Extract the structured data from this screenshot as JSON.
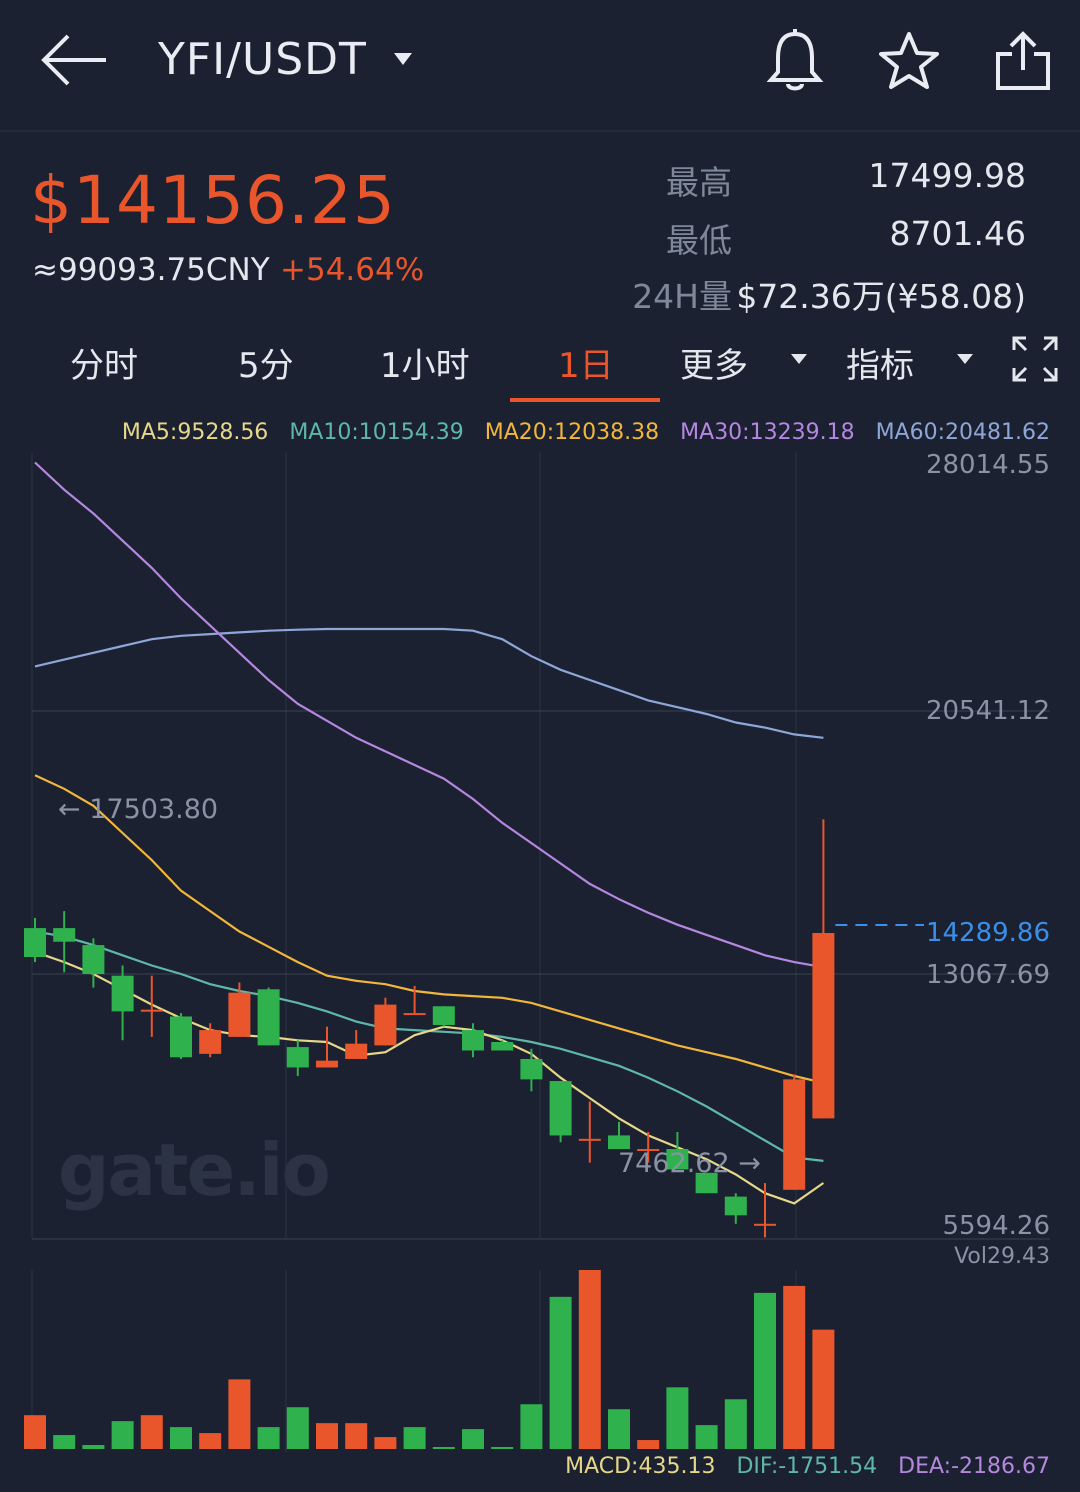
{
  "header": {
    "pair": "YFI/USDT",
    "icons": [
      "back-arrow-icon",
      "caret-down-icon",
      "bell-icon",
      "star-icon",
      "share-icon"
    ]
  },
  "ticker": {
    "price": "$14156.25",
    "cny": "≈99093.75CNY",
    "change": "+54.64%",
    "high_label": "最高",
    "high_value": "17499.98",
    "low_label": "最低",
    "low_value": "8701.46",
    "vol_label": "24H量",
    "vol_value": "$72.36万(¥58.08)"
  },
  "tabs": {
    "items": [
      "分时",
      "5分",
      "1小时",
      "1日",
      "更多",
      "指标"
    ],
    "active": "1日"
  },
  "ma_legend": {
    "ma5": "MA5:9528.56",
    "ma10": "MA10:10154.39",
    "ma20": "MA20:12038.38",
    "ma30": "MA30:13239.18",
    "ma60": "MA60:20481.62"
  },
  "price_axis": {
    "top": "28014.55",
    "mid1": "20541.12",
    "current": "14289.86",
    "mid2": "13067.69",
    "bottom": "5594.26"
  },
  "annotations": {
    "high_marker": "17503.80",
    "low_marker": "7462.62",
    "watermark": "gate.io"
  },
  "volume": {
    "label": "Vol29.43"
  },
  "macd": {
    "macd": "MACD:435.13",
    "dif": "DIF:-1751.54",
    "dea": "DEA:-2186.67"
  },
  "colors": {
    "up": "#e9562c",
    "down": "#2fb24e",
    "ma5": "#e6d789",
    "ma10": "#5fb8a7",
    "ma20": "#f2b63c",
    "ma30": "#b587e0",
    "ma60": "#8ea6d8",
    "current_line": "#3a8fe8"
  },
  "chart_data": {
    "type": "candlestick",
    "y_range": [
      5594.26,
      28014.55
    ],
    "candles": [
      {
        "o": 14300,
        "c": 13450,
        "h": 14600,
        "l": 13300
      },
      {
        "o": 14300,
        "c": 13900,
        "h": 14800,
        "l": 13000
      },
      {
        "o": 13800,
        "c": 12950,
        "h": 14000,
        "l": 12550
      },
      {
        "o": 12900,
        "c": 11850,
        "h": 13200,
        "l": 11000
      },
      {
        "o": 11850,
        "c": 11900,
        "h": 12900,
        "l": 11100
      },
      {
        "o": 11700,
        "c": 10500,
        "h": 11800,
        "l": 10450
      },
      {
        "o": 10600,
        "c": 11300,
        "h": 11500,
        "l": 10500
      },
      {
        "o": 11100,
        "c": 12400,
        "h": 12700,
        "l": 11100
      },
      {
        "o": 12500,
        "c": 10850,
        "h": 12550,
        "l": 10850
      },
      {
        "o": 10800,
        "c": 10200,
        "h": 11000,
        "l": 9950
      },
      {
        "o": 10200,
        "c": 10400,
        "h": 11400,
        "l": 10200
      },
      {
        "o": 10450,
        "c": 10900,
        "h": 11300,
        "l": 10450
      },
      {
        "o": 10850,
        "c": 12050,
        "h": 12250,
        "l": 10850
      },
      {
        "o": 11800,
        "c": 11800,
        "h": 12600,
        "l": 11800
      },
      {
        "o": 12000,
        "c": 11450,
        "h": 12000,
        "l": 11400
      },
      {
        "o": 11300,
        "c": 10700,
        "h": 11500,
        "l": 10500
      },
      {
        "o": 10950,
        "c": 10700,
        "h": 11000,
        "l": 10700
      },
      {
        "o": 10450,
        "c": 9850,
        "h": 10750,
        "l": 9500
      },
      {
        "o": 9800,
        "c": 8200,
        "h": 9800,
        "l": 8000
      },
      {
        "o": 8100,
        "c": 8100,
        "h": 9200,
        "l": 7400
      },
      {
        "o": 8200,
        "c": 7800,
        "h": 8600,
        "l": 7800
      },
      {
        "o": 7800,
        "c": 7800,
        "h": 8300,
        "l": 7400
      },
      {
        "o": 7800,
        "c": 7200,
        "h": 8300,
        "l": 7200
      },
      {
        "o": 7100,
        "c": 6500,
        "h": 7100,
        "l": 6500
      },
      {
        "o": 6400,
        "c": 5850,
        "h": 6500,
        "l": 5600
      },
      {
        "o": 5600,
        "c": 5600,
        "h": 6800,
        "l": 5200
      },
      {
        "o": 6600,
        "c": 9850,
        "h": 10000,
        "l": 6600
      },
      {
        "o": 8701.46,
        "c": 14156.25,
        "h": 17499.98,
        "l": 8701.46
      }
    ],
    "ma5": [
      13600,
      13300,
      12950,
      12500,
      12050,
      11650,
      11300,
      11150,
      11100,
      11000,
      10950,
      10550,
      10650,
      11150,
      11400,
      11300,
      11000,
      10600,
      9900,
      9300,
      8700,
      8200,
      7850,
      7500,
      7050,
      6500,
      6200,
      6800
    ],
    "ma10": [
      14200,
      14050,
      13800,
      13500,
      13200,
      12950,
      12650,
      12450,
      12300,
      12100,
      11850,
      11550,
      11350,
      11300,
      11250,
      11200,
      11100,
      10950,
      10750,
      10500,
      10250,
      9900,
      9500,
      9050,
      8550,
      8050,
      7550,
      7450
    ],
    "ma20": [
      18800,
      18400,
      17900,
      17100,
      16300,
      15400,
      14800,
      14200,
      13750,
      13300,
      12900,
      12750,
      12650,
      12450,
      12350,
      12300,
      12250,
      12100,
      11850,
      11600,
      11350,
      11100,
      10850,
      10650,
      10450,
      10200,
      9950,
      9750
    ],
    "ma30": [
      28000,
      27200,
      26500,
      25700,
      24900,
      24000,
      23200,
      22400,
      21600,
      20900,
      20400,
      19900,
      19500,
      19100,
      18700,
      18100,
      17400,
      16800,
      16200,
      15600,
      15150,
      14750,
      14400,
      14100,
      13800,
      13500,
      13300,
      13150
    ],
    "ma60": [
      22000,
      22200,
      22400,
      22600,
      22800,
      22900,
      22950,
      23000,
      23050,
      23080,
      23100,
      23100,
      23100,
      23100,
      23100,
      23050,
      22800,
      22300,
      21900,
      21600,
      21300,
      21000,
      20800,
      20600,
      20350,
      20200,
      20000,
      19900
    ],
    "volumes": [
      {
        "v": 34,
        "up": true
      },
      {
        "v": 14,
        "up": false
      },
      {
        "v": 4,
        "up": false
      },
      {
        "v": 28,
        "up": false
      },
      {
        "v": 34,
        "up": true
      },
      {
        "v": 22,
        "up": false
      },
      {
        "v": 16,
        "up": true
      },
      {
        "v": 70,
        "up": true
      },
      {
        "v": 22,
        "up": false
      },
      {
        "v": 42,
        "up": false
      },
      {
        "v": 26,
        "up": true
      },
      {
        "v": 26,
        "up": true
      },
      {
        "v": 12,
        "up": true
      },
      {
        "v": 22,
        "up": false
      },
      {
        "v": 0,
        "up": false
      },
      {
        "v": 20,
        "up": false
      },
      {
        "v": 2,
        "up": false
      },
      {
        "v": 45,
        "up": false
      },
      {
        "v": 153,
        "up": false
      },
      {
        "v": 180,
        "up": true
      },
      {
        "v": 40,
        "up": false
      },
      {
        "v": 9,
        "up": true
      },
      {
        "v": 62,
        "up": false
      },
      {
        "v": 24,
        "up": false
      },
      {
        "v": 50,
        "up": false
      },
      {
        "v": 157,
        "up": false
      },
      {
        "v": 164,
        "up": true
      },
      {
        "v": 120,
        "up": true
      }
    ],
    "volume_max": 180
  }
}
